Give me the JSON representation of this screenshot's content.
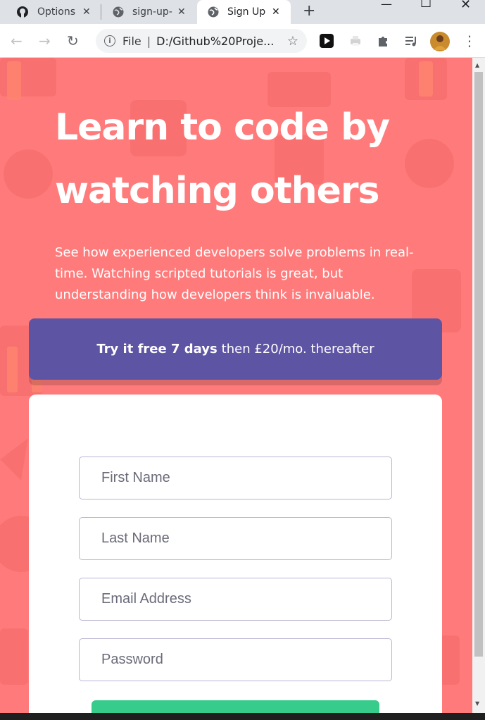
{
  "browser": {
    "tabs": [
      {
        "title": "Options",
        "icon": "github-icon",
        "active": false
      },
      {
        "title": "sign-up-",
        "icon": "globe-icon",
        "active": false
      },
      {
        "title": "Sign Up",
        "icon": "globe-icon",
        "active": true
      }
    ],
    "address": {
      "scheme_label": "File",
      "url": "D:/Github%20Proje..."
    }
  },
  "page": {
    "headline": "Learn to code by watching others",
    "lead": "See how experienced developers solve problems in real-time. Watching scripted tutorials is great, but understanding how developers think is invaluable.",
    "trial": {
      "strong": "Try it free 7 days",
      "rest": "then £20/mo. thereafter"
    },
    "form": {
      "first_name_placeholder": "First Name",
      "last_name_placeholder": "Last Name",
      "email_placeholder": "Email Address",
      "password_placeholder": "Password"
    }
  },
  "colors": {
    "background": "#ff7a7a",
    "banner": "#5e54a4",
    "submit": "#38cc8c"
  }
}
